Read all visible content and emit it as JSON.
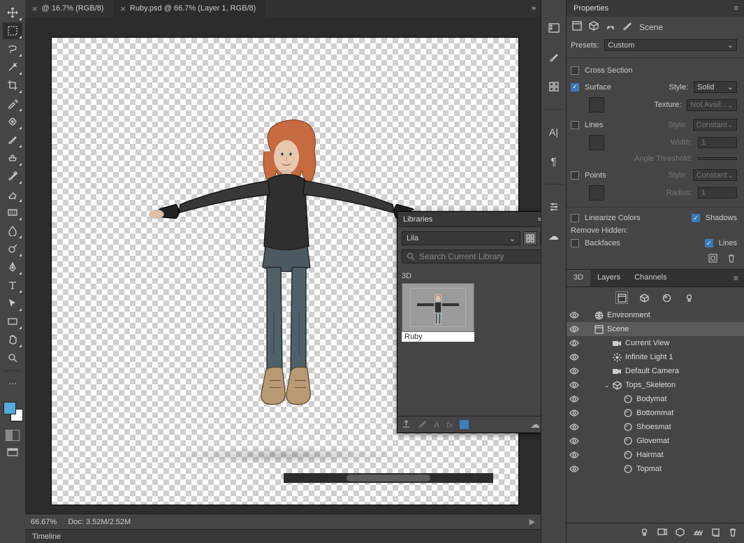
{
  "tabs": [
    {
      "label": "@ 16.7% (RGB/8)",
      "active": false
    },
    {
      "label": "Ruby.psd @ 66.7% (Layer 1, RGB/8)",
      "active": true
    }
  ],
  "libraries": {
    "title": "Libraries",
    "current": "Lila",
    "search_placeholder": "Search Current Library",
    "section": "3D",
    "asset_name": "Ruby"
  },
  "status": {
    "zoom": "66.67%",
    "doc": "Doc: 3.52M/2.52M"
  },
  "timeline": {
    "label": "Timeline"
  },
  "properties": {
    "title": "Properties",
    "scene_label": "Scene",
    "presets_label": "Presets:",
    "preset_value": "Custom",
    "cross_section": "Cross Section",
    "surface": "Surface",
    "style_label": "Style:",
    "style_surface": "Solid",
    "texture_label": "Texture:",
    "texture_value": "Not Avail...",
    "lines": "Lines",
    "style_lines": "Constant",
    "width_label": "Width:",
    "width_value": "1",
    "angle_label": "Angle Threshold:",
    "points": "Points",
    "style_points": "Constant",
    "radius_label": "Radius:",
    "radius_value": "1",
    "linearize": "Linearize Colors",
    "shadows": "Shadows",
    "remove_hidden": "Remove Hidden:",
    "backfaces": "Backfaces",
    "lines2": "Lines"
  },
  "panel3d": {
    "tabs": [
      "3D",
      "Layers",
      "Channels"
    ],
    "items": [
      {
        "depth": 0,
        "icon": "env",
        "name": "Environment",
        "sel": false
      },
      {
        "depth": 0,
        "icon": "scene",
        "name": "Scene",
        "sel": true
      },
      {
        "depth": 1,
        "icon": "camera",
        "name": "Current View",
        "sel": false
      },
      {
        "depth": 1,
        "icon": "light",
        "name": "Infinite Light 1",
        "sel": false
      },
      {
        "depth": 1,
        "icon": "camera",
        "name": "Default Camera",
        "sel": false
      },
      {
        "depth": 1,
        "icon": "mesh",
        "name": "Tops_Skeleton",
        "sel": false,
        "expand": true
      },
      {
        "depth": 2,
        "icon": "mat",
        "name": "Bodymat",
        "sel": false
      },
      {
        "depth": 2,
        "icon": "mat",
        "name": "Bottommat",
        "sel": false
      },
      {
        "depth": 2,
        "icon": "mat",
        "name": "Shoesmat",
        "sel": false
      },
      {
        "depth": 2,
        "icon": "mat",
        "name": "Glovemat",
        "sel": false
      },
      {
        "depth": 2,
        "icon": "mat",
        "name": "Hairmat",
        "sel": false
      },
      {
        "depth": 2,
        "icon": "mat",
        "name": "Topmat",
        "sel": false
      }
    ]
  },
  "colors": {
    "fg": "#55aadd",
    "bg": "#ffffff"
  }
}
